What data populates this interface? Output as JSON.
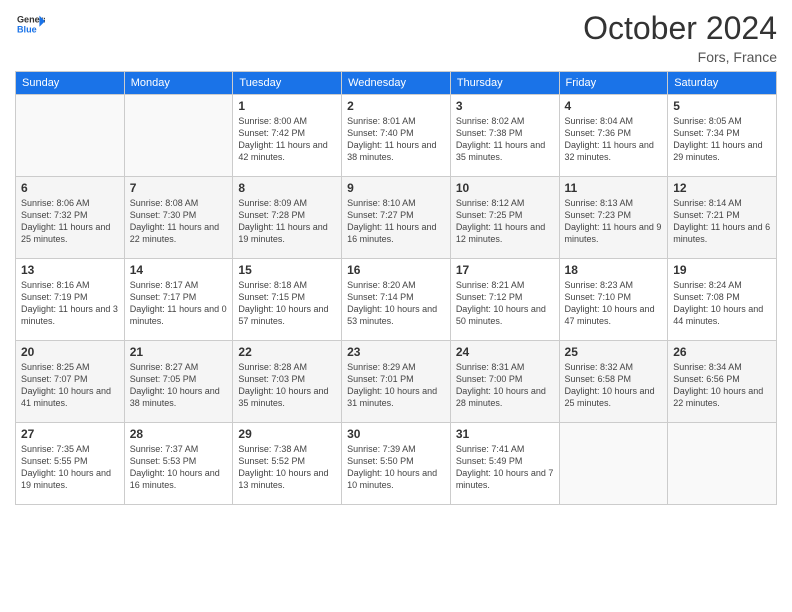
{
  "header": {
    "logo_general": "General",
    "logo_blue": "Blue",
    "month_title": "October 2024",
    "location": "Fors, France"
  },
  "weekdays": [
    "Sunday",
    "Monday",
    "Tuesday",
    "Wednesday",
    "Thursday",
    "Friday",
    "Saturday"
  ],
  "weeks": [
    [
      {
        "day": "",
        "info": ""
      },
      {
        "day": "",
        "info": ""
      },
      {
        "day": "1",
        "info": "Sunrise: 8:00 AM\nSunset: 7:42 PM\nDaylight: 11 hours and 42 minutes."
      },
      {
        "day": "2",
        "info": "Sunrise: 8:01 AM\nSunset: 7:40 PM\nDaylight: 11 hours and 38 minutes."
      },
      {
        "day": "3",
        "info": "Sunrise: 8:02 AM\nSunset: 7:38 PM\nDaylight: 11 hours and 35 minutes."
      },
      {
        "day": "4",
        "info": "Sunrise: 8:04 AM\nSunset: 7:36 PM\nDaylight: 11 hours and 32 minutes."
      },
      {
        "day": "5",
        "info": "Sunrise: 8:05 AM\nSunset: 7:34 PM\nDaylight: 11 hours and 29 minutes."
      }
    ],
    [
      {
        "day": "6",
        "info": "Sunrise: 8:06 AM\nSunset: 7:32 PM\nDaylight: 11 hours and 25 minutes."
      },
      {
        "day": "7",
        "info": "Sunrise: 8:08 AM\nSunset: 7:30 PM\nDaylight: 11 hours and 22 minutes."
      },
      {
        "day": "8",
        "info": "Sunrise: 8:09 AM\nSunset: 7:28 PM\nDaylight: 11 hours and 19 minutes."
      },
      {
        "day": "9",
        "info": "Sunrise: 8:10 AM\nSunset: 7:27 PM\nDaylight: 11 hours and 16 minutes."
      },
      {
        "day": "10",
        "info": "Sunrise: 8:12 AM\nSunset: 7:25 PM\nDaylight: 11 hours and 12 minutes."
      },
      {
        "day": "11",
        "info": "Sunrise: 8:13 AM\nSunset: 7:23 PM\nDaylight: 11 hours and 9 minutes."
      },
      {
        "day": "12",
        "info": "Sunrise: 8:14 AM\nSunset: 7:21 PM\nDaylight: 11 hours and 6 minutes."
      }
    ],
    [
      {
        "day": "13",
        "info": "Sunrise: 8:16 AM\nSunset: 7:19 PM\nDaylight: 11 hours and 3 minutes."
      },
      {
        "day": "14",
        "info": "Sunrise: 8:17 AM\nSunset: 7:17 PM\nDaylight: 11 hours and 0 minutes."
      },
      {
        "day": "15",
        "info": "Sunrise: 8:18 AM\nSunset: 7:15 PM\nDaylight: 10 hours and 57 minutes."
      },
      {
        "day": "16",
        "info": "Sunrise: 8:20 AM\nSunset: 7:14 PM\nDaylight: 10 hours and 53 minutes."
      },
      {
        "day": "17",
        "info": "Sunrise: 8:21 AM\nSunset: 7:12 PM\nDaylight: 10 hours and 50 minutes."
      },
      {
        "day": "18",
        "info": "Sunrise: 8:23 AM\nSunset: 7:10 PM\nDaylight: 10 hours and 47 minutes."
      },
      {
        "day": "19",
        "info": "Sunrise: 8:24 AM\nSunset: 7:08 PM\nDaylight: 10 hours and 44 minutes."
      }
    ],
    [
      {
        "day": "20",
        "info": "Sunrise: 8:25 AM\nSunset: 7:07 PM\nDaylight: 10 hours and 41 minutes."
      },
      {
        "day": "21",
        "info": "Sunrise: 8:27 AM\nSunset: 7:05 PM\nDaylight: 10 hours and 38 minutes."
      },
      {
        "day": "22",
        "info": "Sunrise: 8:28 AM\nSunset: 7:03 PM\nDaylight: 10 hours and 35 minutes."
      },
      {
        "day": "23",
        "info": "Sunrise: 8:29 AM\nSunset: 7:01 PM\nDaylight: 10 hours and 31 minutes."
      },
      {
        "day": "24",
        "info": "Sunrise: 8:31 AM\nSunset: 7:00 PM\nDaylight: 10 hours and 28 minutes."
      },
      {
        "day": "25",
        "info": "Sunrise: 8:32 AM\nSunset: 6:58 PM\nDaylight: 10 hours and 25 minutes."
      },
      {
        "day": "26",
        "info": "Sunrise: 8:34 AM\nSunset: 6:56 PM\nDaylight: 10 hours and 22 minutes."
      }
    ],
    [
      {
        "day": "27",
        "info": "Sunrise: 7:35 AM\nSunset: 5:55 PM\nDaylight: 10 hours and 19 minutes."
      },
      {
        "day": "28",
        "info": "Sunrise: 7:37 AM\nSunset: 5:53 PM\nDaylight: 10 hours and 16 minutes."
      },
      {
        "day": "29",
        "info": "Sunrise: 7:38 AM\nSunset: 5:52 PM\nDaylight: 10 hours and 13 minutes."
      },
      {
        "day": "30",
        "info": "Sunrise: 7:39 AM\nSunset: 5:50 PM\nDaylight: 10 hours and 10 minutes."
      },
      {
        "day": "31",
        "info": "Sunrise: 7:41 AM\nSunset: 5:49 PM\nDaylight: 10 hours and 7 minutes."
      },
      {
        "day": "",
        "info": ""
      },
      {
        "day": "",
        "info": ""
      }
    ]
  ]
}
